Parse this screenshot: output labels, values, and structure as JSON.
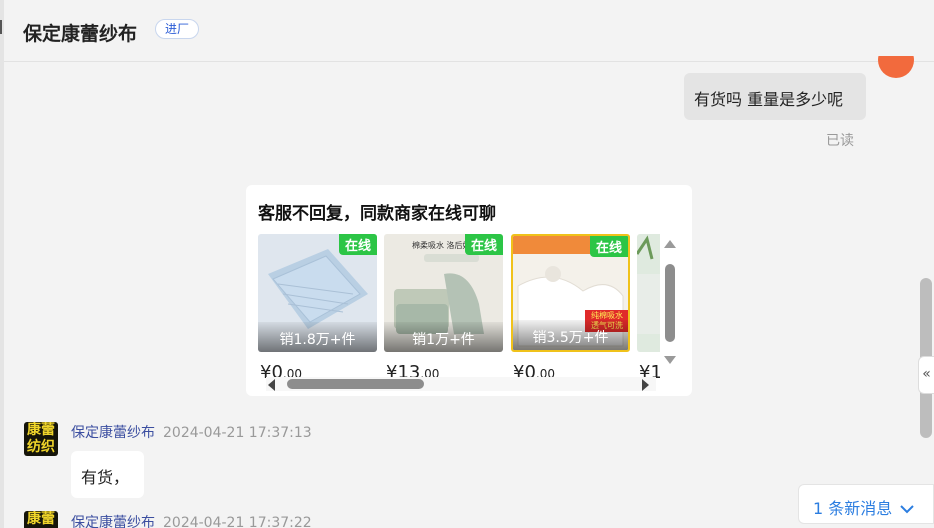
{
  "header": {
    "shop_name": "保定康蕾纱布",
    "tag": "进厂"
  },
  "outgoing": {
    "text": "有货吗 重量是多少呢",
    "status": "已读"
  },
  "recommend_card": {
    "title": "客服不回复，同款商家在线可聊",
    "products": [
      {
        "badge": "在线",
        "sales": "销1.8万+件",
        "price_int": "¥0",
        "price_dec": ".00"
      },
      {
        "badge": "在线",
        "sales": "销1万+件",
        "price_int": "¥13",
        "price_dec": ".00",
        "image_text": "棉柔吸水 洛后好"
      },
      {
        "badge": "在线",
        "sales": "销3.5万+件",
        "price_int": "¥0",
        "price_dec": ".00",
        "image_text": "纯棉吸水 透气可洗"
      },
      {
        "price_int": "¥1"
      }
    ]
  },
  "messages": [
    {
      "avatar_text": "康蕾纺织",
      "sender": "保定康蕾纱布",
      "time": "2024-04-21 17:37:13",
      "text": "有货，"
    },
    {
      "avatar_text": "康蕾",
      "sender": "保定康蕾纱布",
      "time": "2024-04-21 17:37:22"
    }
  ],
  "collapse_icon": "«",
  "new_messages": "1 条新消息"
}
